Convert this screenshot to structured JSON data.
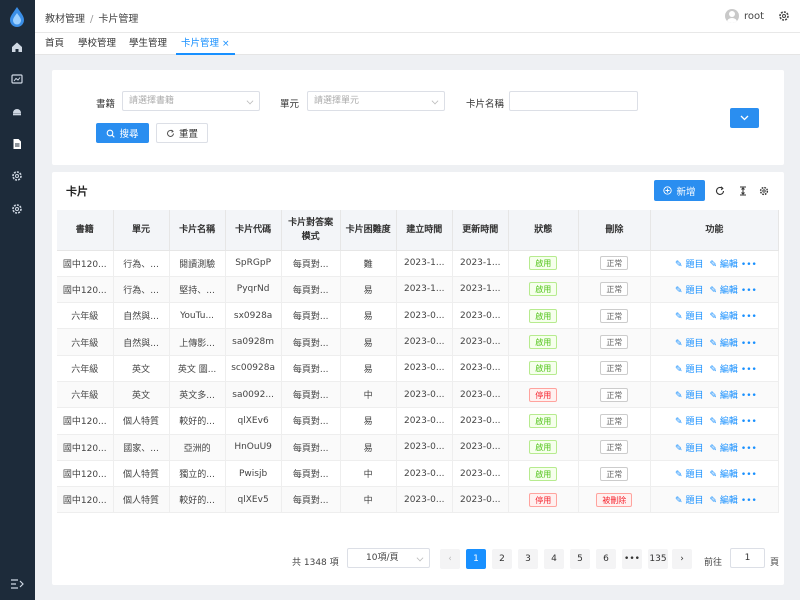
{
  "breadcrumb": {
    "root": "教材管理",
    "current": "卡片管理"
  },
  "user": {
    "name": "root"
  },
  "tabs": [
    {
      "label": "首頁"
    },
    {
      "label": "學校管理"
    },
    {
      "label": "學生管理"
    },
    {
      "label": "卡片管理",
      "close": "×"
    }
  ],
  "filter": {
    "book_label": "書籍",
    "book_placeholder": "請選擇書籍",
    "unit_label": "單元",
    "unit_placeholder": "請選擇單元",
    "name_label": "卡片名稱",
    "search_label": "搜尋",
    "reset_label": "重置"
  },
  "table": {
    "title": "卡片",
    "add_label": "新增",
    "headers": [
      "書籍",
      "單元",
      "卡片名稱",
      "卡片代碼",
      "卡片對答案模式",
      "卡片困難度",
      "建立時間",
      "更新時間",
      "狀態",
      "刪除",
      "功能"
    ],
    "action_topic": "題目",
    "action_edit": "編輯",
    "action_more": "•••",
    "rows": [
      {
        "book": "國中120...",
        "unit": "行為、...",
        "name": "閱讀測驗",
        "code": "SpRGpP",
        "mode": "每頁對...",
        "level": "難",
        "created": "2023-1...",
        "updated": "2023-1...",
        "status": "啟用",
        "del": "正常"
      },
      {
        "book": "國中120...",
        "unit": "行為、...",
        "name": "堅持、...",
        "code": "PyqrNd",
        "mode": "每頁對...",
        "level": "易",
        "created": "2023-1...",
        "updated": "2023-1...",
        "status": "啟用",
        "del": "正常"
      },
      {
        "book": "六年級",
        "unit": "自然與...",
        "name": "YouTu...",
        "code": "sx0928a",
        "mode": "每頁對...",
        "level": "易",
        "created": "2023-0...",
        "updated": "2023-0...",
        "status": "啟用",
        "del": "正常"
      },
      {
        "book": "六年級",
        "unit": "自然與...",
        "name": "上傳影...",
        "code": "sa0928m",
        "mode": "每頁對...",
        "level": "易",
        "created": "2023-0...",
        "updated": "2023-0...",
        "status": "啟用",
        "del": "正常"
      },
      {
        "book": "六年級",
        "unit": "英文",
        "name": "英文 圖...",
        "code": "sc00928a",
        "mode": "每頁對...",
        "level": "易",
        "created": "2023-0...",
        "updated": "2023-0...",
        "status": "啟用",
        "del": "正常"
      },
      {
        "book": "六年級",
        "unit": "英文",
        "name": "英文多...",
        "code": "sa0092...",
        "mode": "每頁對...",
        "level": "中",
        "created": "2023-0...",
        "updated": "2023-0...",
        "status": "停用",
        "del": "正常"
      },
      {
        "book": "國中120...",
        "unit": "個人特質",
        "name": "較好的...",
        "code": "qlXEv6",
        "mode": "每頁對...",
        "level": "易",
        "created": "2023-0...",
        "updated": "2023-0...",
        "status": "啟用",
        "del": "正常"
      },
      {
        "book": "國中120...",
        "unit": "國家、...",
        "name": "亞洲的",
        "code": "HnOuU9",
        "mode": "每頁對...",
        "level": "易",
        "created": "2023-0...",
        "updated": "2023-0...",
        "status": "啟用",
        "del": "正常"
      },
      {
        "book": "國中120...",
        "unit": "個人特質",
        "name": "獨立的...",
        "code": "Pwisjb",
        "mode": "每頁對...",
        "level": "中",
        "created": "2023-0...",
        "updated": "2023-0...",
        "status": "啟用",
        "del": "正常"
      },
      {
        "book": "國中120...",
        "unit": "個人特質",
        "name": "較好的...",
        "code": "qlXEv5",
        "mode": "每頁對...",
        "level": "中",
        "created": "2023-0...",
        "updated": "2023-0...",
        "status": "停用",
        "del": "被刪除"
      }
    ]
  },
  "pagination": {
    "total": "共 1348 項",
    "page_size": "10項/頁",
    "pages": [
      "1",
      "2",
      "3",
      "4",
      "5",
      "6",
      "•••",
      "135"
    ],
    "goto_label": "前往",
    "goto_value": "1",
    "goto_suffix": "頁"
  },
  "colors": {
    "primary": "#1890ff",
    "sidebar": "#1d2b3a"
  }
}
